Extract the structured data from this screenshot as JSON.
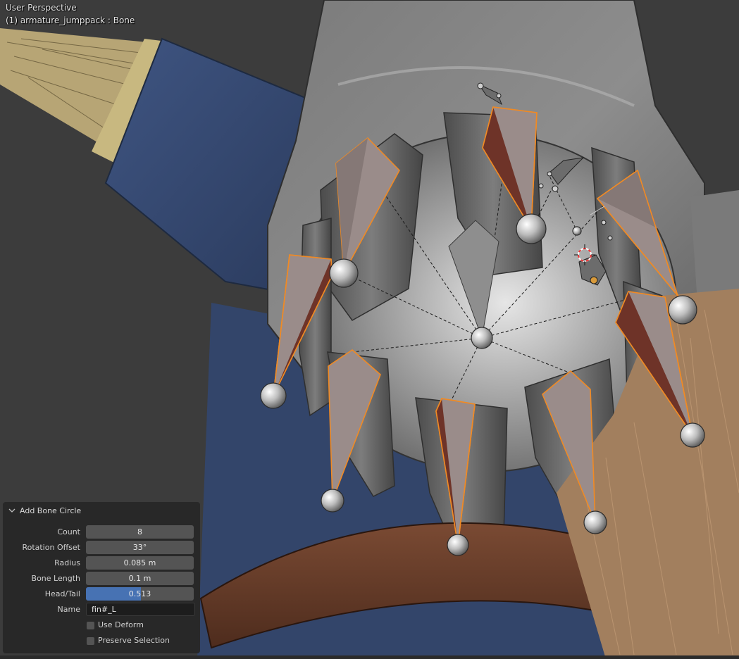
{
  "viewport": {
    "title": "User Perspective",
    "subtitle": "(1) armature_jumppack : Bone"
  },
  "operator_panel": {
    "title": "Add Bone Circle",
    "fields": [
      {
        "label": "Count",
        "value": "8"
      },
      {
        "label": "Rotation Offset",
        "value": "33°"
      },
      {
        "label": "Radius",
        "value": "0.085 m"
      },
      {
        "label": "Bone Length",
        "value": "0.1 m"
      },
      {
        "label": "Head/Tail",
        "value": "0.513",
        "fraction": 0.513
      },
      {
        "label": "Name",
        "value": "fin#_L"
      }
    ],
    "checkboxes": [
      {
        "label": "Use Deform",
        "checked": false
      },
      {
        "label": "Preserve Selection",
        "checked": false
      }
    ]
  },
  "colors": {
    "accent": "#4772b3",
    "bone_outline": "#f08a24",
    "bone_face": "#9a8c8a",
    "bone_dark_face": "#6e3328"
  }
}
